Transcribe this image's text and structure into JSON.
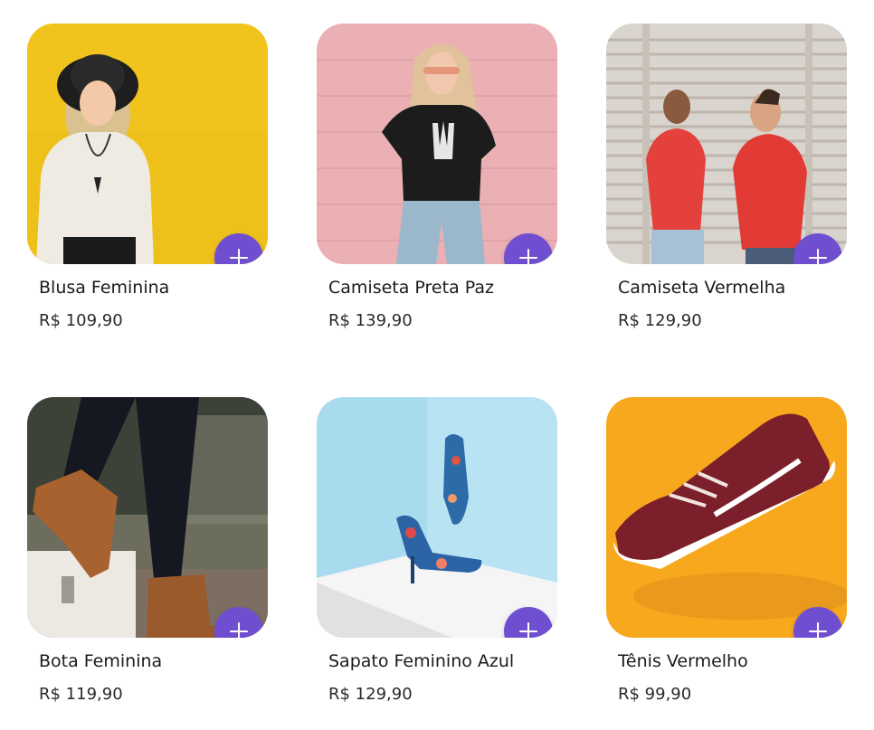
{
  "accent_color": "#6f4fcf",
  "products": [
    {
      "name": "Blusa Feminina",
      "price": "R$ 109,90",
      "add_icon": "plus-icon"
    },
    {
      "name": "Camiseta Preta Paz",
      "price": "R$ 139,90",
      "add_icon": "plus-icon"
    },
    {
      "name": "Camiseta Vermelha",
      "price": "R$ 129,90",
      "add_icon": "plus-icon"
    },
    {
      "name": "Bota Feminina",
      "price": "R$ 119,90",
      "add_icon": "plus-icon"
    },
    {
      "name": "Sapato Feminino Azul",
      "price": "R$ 129,90",
      "add_icon": "plus-icon"
    },
    {
      "name": "Tênis Vermelho",
      "price": "R$ 99,90",
      "add_icon": "plus-icon"
    }
  ]
}
